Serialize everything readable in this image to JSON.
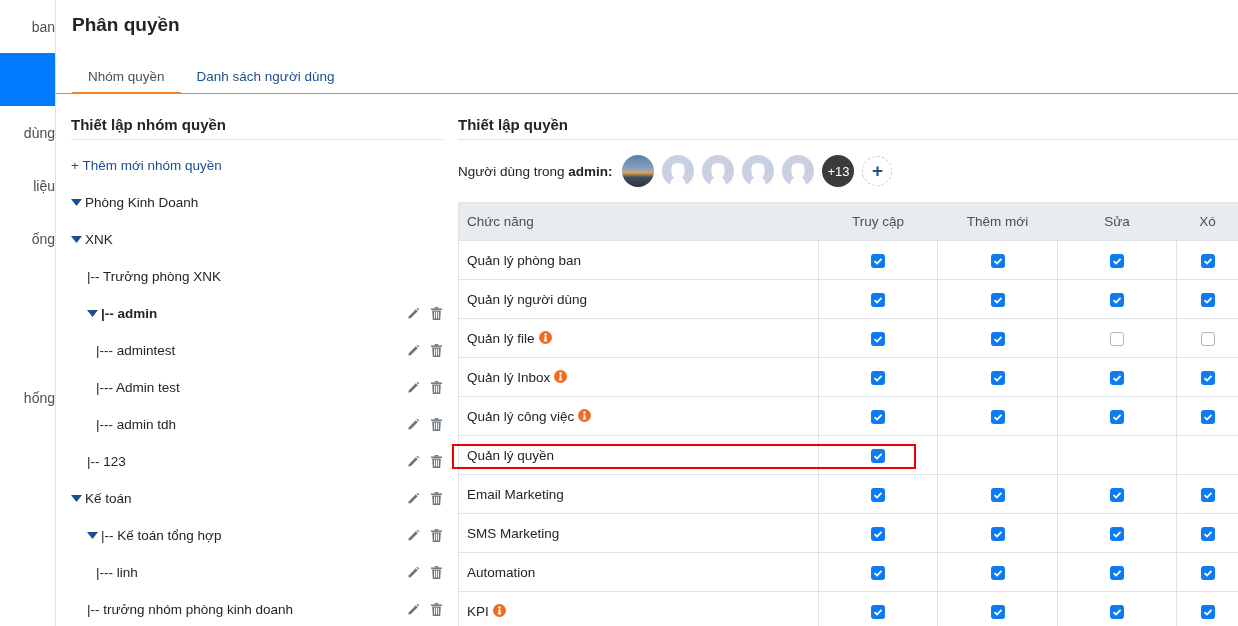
{
  "sidebar": {
    "items": [
      {
        "label": "ban",
        "selected": false
      },
      {
        "selected": true
      },
      {
        "label": "dùng",
        "selected": false
      },
      {
        "label": "liệu",
        "selected": false
      },
      {
        "label": "ống",
        "selected": false
      },
      {
        "label": "hống",
        "selected": false
      }
    ]
  },
  "page": {
    "title": "Phân quyền"
  },
  "tabs": [
    {
      "label": "Nhóm quyền",
      "selected": true
    },
    {
      "label": "Danh sách người dùng",
      "selected": false
    }
  ],
  "groups_panel": {
    "title": "Thiết lập nhóm quyền",
    "add_link": "+ Thêm mới nhóm quyền",
    "tree": [
      {
        "label": "Phòng Kinh Doanh",
        "expanded": true,
        "selected": false,
        "actions": false
      },
      {
        "label": "XNK",
        "expanded": true,
        "selected": false,
        "actions": false,
        "children": [
          {
            "label": "|-- Trưởng phòng XNK",
            "selected": false,
            "actions": false
          },
          {
            "label": "|-- admin",
            "expanded": true,
            "selected": true,
            "actions": true,
            "children": [
              {
                "label": "|--- admintest",
                "selected": false,
                "actions": true
              },
              {
                "label": "|--- Admin test",
                "selected": false,
                "actions": true
              },
              {
                "label": "|--- admin tdh",
                "selected": false,
                "actions": true
              }
            ]
          },
          {
            "label": "|-- 123",
            "selected": false,
            "actions": true
          }
        ]
      },
      {
        "label": "Kế toán",
        "expanded": true,
        "selected": false,
        "actions": true,
        "children": [
          {
            "label": "|-- Kế toán tổng hợp",
            "expanded": true,
            "selected": false,
            "actions": true,
            "children": [
              {
                "label": "|--- linh",
                "selected": false,
                "actions": true
              }
            ]
          },
          {
            "label": "|-- trưởng nhóm phòng kinh doanh",
            "selected": false,
            "actions": true
          }
        ]
      }
    ]
  },
  "permissions_panel": {
    "title": "Thiết lập quyền",
    "users_label": "Người dùng trong **admin:**",
    "users": [
      {
        "kind": "photo"
      },
      {
        "kind": "blank"
      },
      {
        "kind": "blank"
      },
      {
        "kind": "blank"
      },
      {
        "kind": "blank"
      }
    ],
    "more_count": "+13",
    "add_user": "+",
    "table": {
      "columns": [
        "Chức năng",
        "Truy cập",
        "Thêm mới",
        "Sửa",
        "Xó"
      ],
      "rows": [
        {
          "name": "Quản lý phòng ban",
          "info": false,
          "highlighted": false,
          "cells": [
            {
              "checked": true
            },
            {
              "checked": true
            },
            {
              "checked": true
            },
            {
              "checked": true
            }
          ]
        },
        {
          "name": "Quản lý người dùng",
          "info": false,
          "highlighted": false,
          "cells": [
            {
              "checked": true
            },
            {
              "checked": true
            },
            {
              "checked": true
            },
            {
              "checked": true
            }
          ]
        },
        {
          "name": "Quản lý file",
          "info": true,
          "highlighted": false,
          "cells": [
            {
              "checked": true
            },
            {
              "checked": true
            },
            {
              "checked": false
            },
            {
              "checked": false
            }
          ]
        },
        {
          "name": "Quản lý Inbox",
          "info": true,
          "highlighted": false,
          "cells": [
            {
              "checked": true
            },
            {
              "checked": true
            },
            {
              "checked": true
            },
            {
              "checked": true
            }
          ]
        },
        {
          "name": "Quản lý công việc",
          "info": true,
          "highlighted": false,
          "cells": [
            {
              "checked": true
            },
            {
              "checked": true
            },
            {
              "checked": true
            },
            {
              "checked": true
            }
          ]
        },
        {
          "name": "Quản lý quyền",
          "info": false,
          "highlighted": true,
          "cells": [
            {
              "checked": true
            }
          ]
        },
        {
          "name": "Email Marketing",
          "info": false,
          "highlighted": false,
          "cells": [
            {
              "checked": true
            },
            {
              "checked": true
            },
            {
              "checked": true
            },
            {
              "checked": true
            }
          ]
        },
        {
          "name": "SMS Marketing",
          "info": false,
          "highlighted": false,
          "cells": [
            {
              "checked": true
            },
            {
              "checked": true
            },
            {
              "checked": true
            },
            {
              "checked": true
            }
          ]
        },
        {
          "name": "Automation",
          "info": false,
          "highlighted": false,
          "cells": [
            {
              "checked": true
            },
            {
              "checked": true
            },
            {
              "checked": true
            },
            {
              "checked": true
            }
          ]
        },
        {
          "name": "KPI",
          "info": true,
          "highlighted": false,
          "cells": [
            {
              "checked": true
            },
            {
              "checked": true
            },
            {
              "checked": true
            },
            {
              "checked": true
            }
          ]
        }
      ]
    }
  }
}
